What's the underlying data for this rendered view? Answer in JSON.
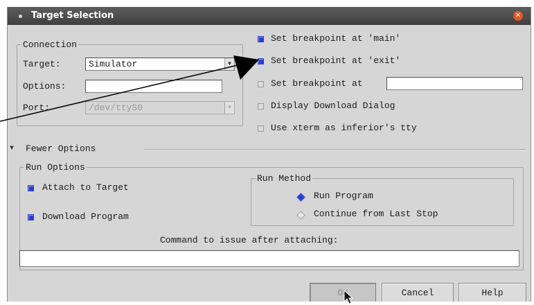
{
  "window": {
    "title": "Target Selection"
  },
  "connection": {
    "legend": "Connection",
    "target_label": "Target:",
    "target_value": "Simulator",
    "options_label": "Options:",
    "options_value": "",
    "port_label": "Port:",
    "port_value": "/dev/ttyS0"
  },
  "breakpoints": {
    "main": {
      "label": "Set breakpoint at 'main'",
      "checked": true
    },
    "exit": {
      "label": "Set breakpoint at 'exit'",
      "checked": true
    },
    "at": {
      "label": "Set breakpoint at",
      "checked": false,
      "value": ""
    },
    "download_dialog": {
      "label": "Display Download Dialog",
      "checked": false
    },
    "xterm": {
      "label": "Use xterm as inferior's tty",
      "checked": false
    }
  },
  "fewer_options": {
    "label": "Fewer Options"
  },
  "run_options": {
    "legend": "Run Options",
    "attach": {
      "label": "Attach to Target",
      "checked": true
    },
    "download": {
      "label": "Download Program",
      "checked": true
    },
    "run_method": {
      "legend": "Run Method",
      "run_program": {
        "label": "Run Program",
        "selected": true
      },
      "continue": {
        "label": "Continue from Last Stop",
        "selected": false
      }
    },
    "command_label": "Command to issue after attaching:",
    "command_value": ""
  },
  "buttons": {
    "ok": "OK",
    "cancel": "Cancel",
    "help": "Help"
  },
  "colors": {
    "titlebar": "#4a4a4a",
    "dialog_bg": "#d6d6d6",
    "check_on": "#2a3ecf",
    "close": "#e4572b"
  },
  "icons": {
    "close": "close-icon",
    "expander": "triangle-down-icon",
    "combo": "chevron-down-icon",
    "cursor": "mouse-pointer-icon"
  }
}
